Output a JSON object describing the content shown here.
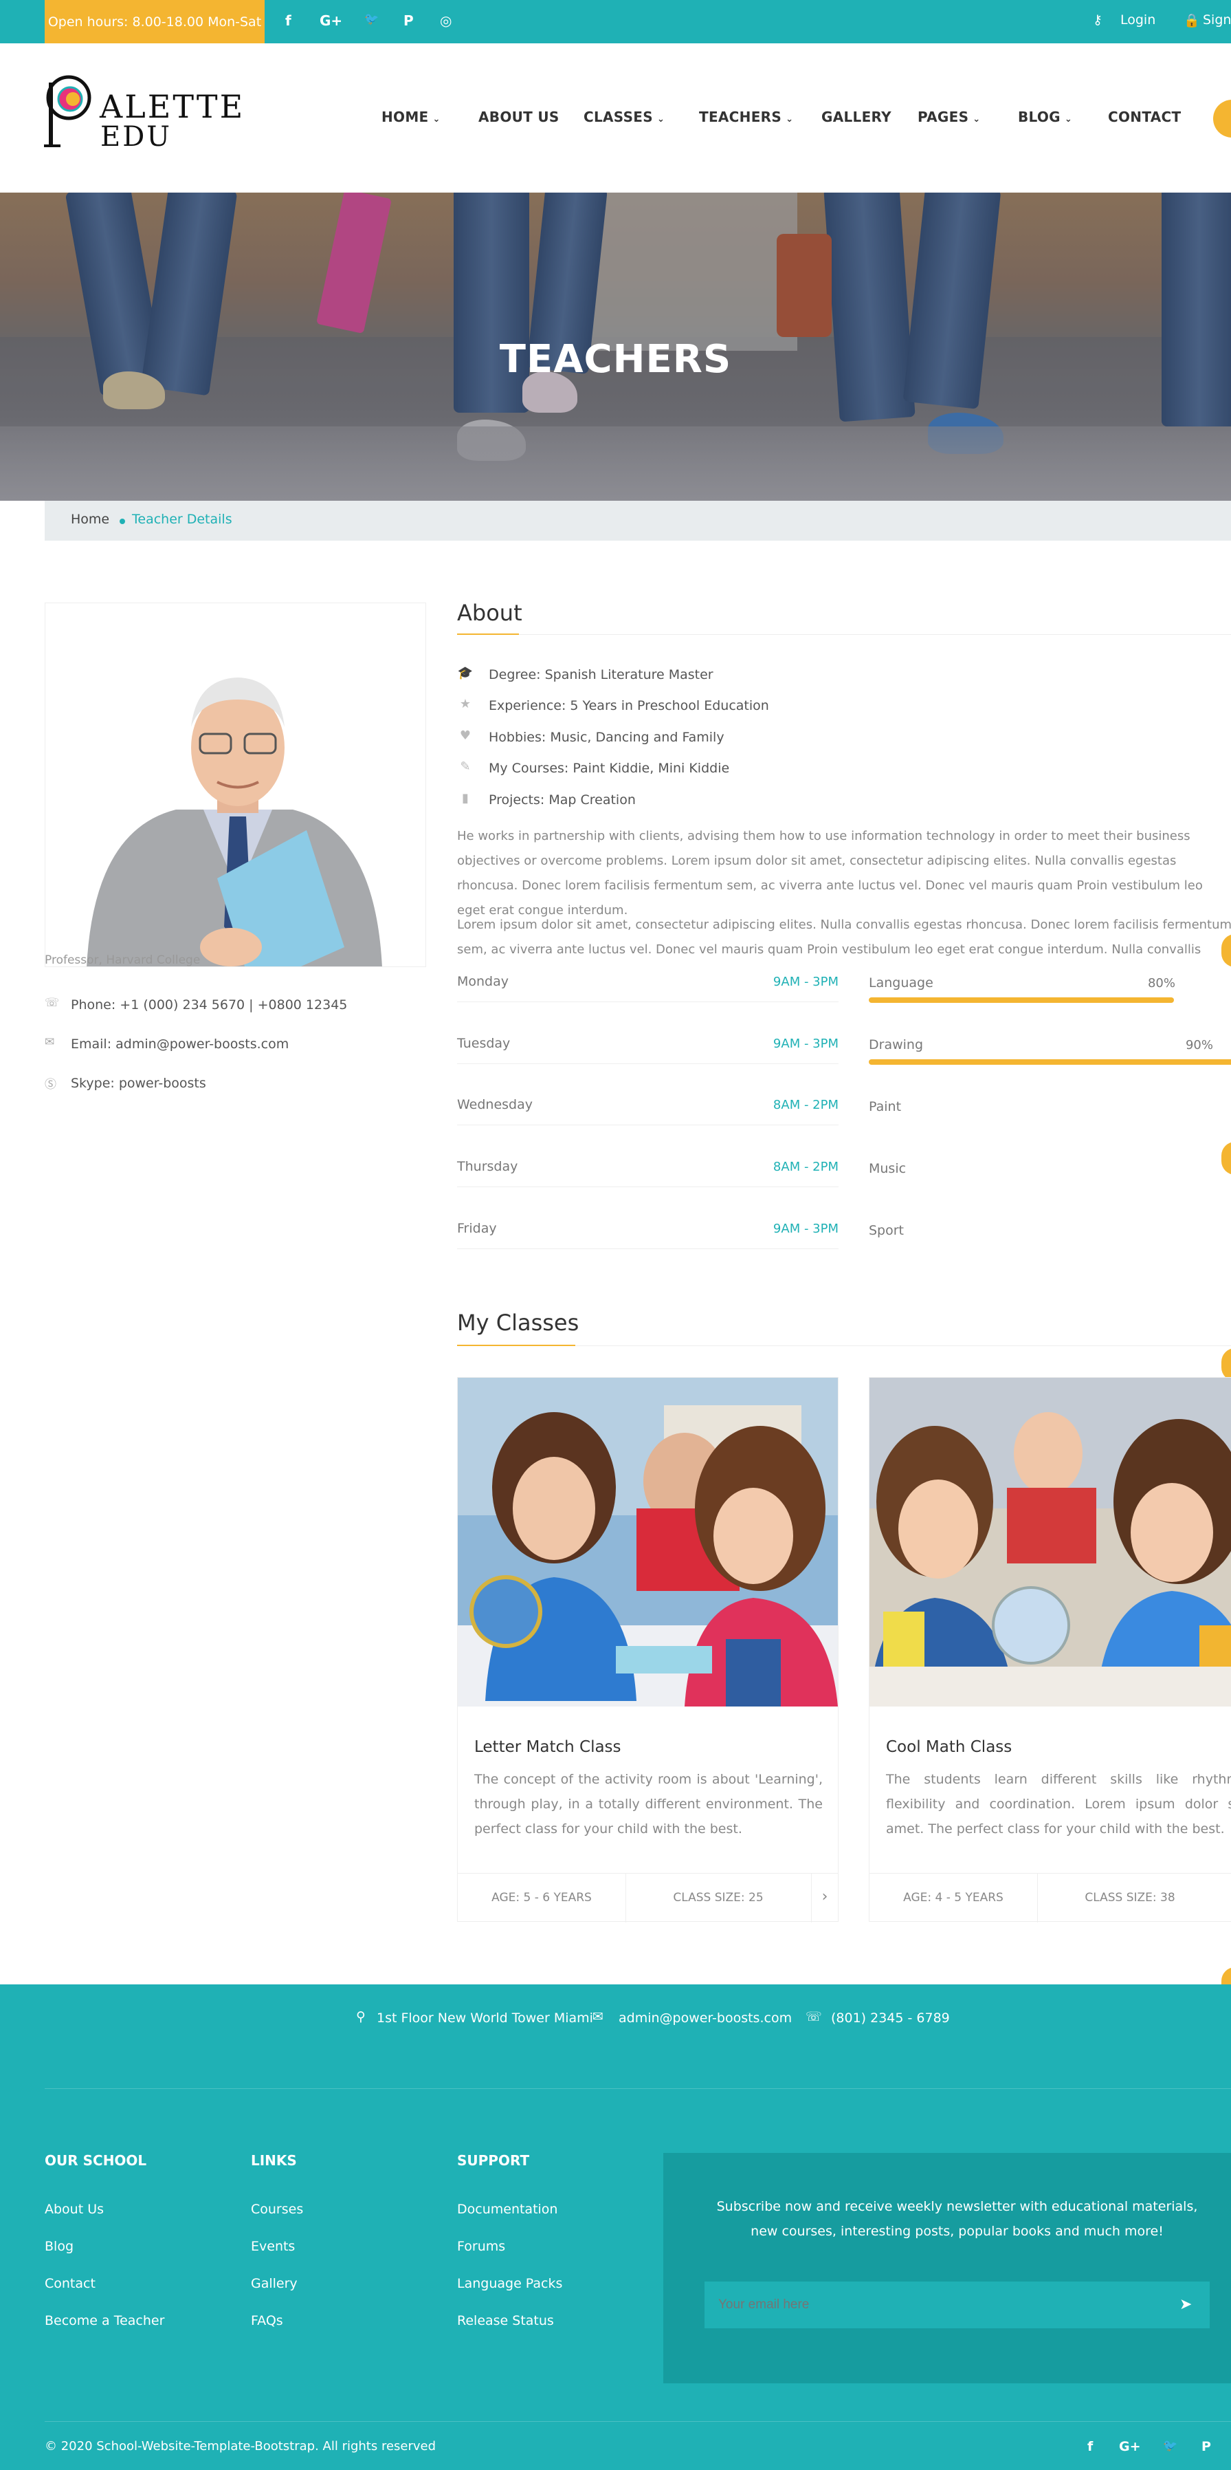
{
  "topbar": {
    "hours": "Open hours: 8.00-18.00 Mon-Sat",
    "social": [
      "f",
      "G+",
      "🐦",
      "P",
      "◎"
    ],
    "login": "Login",
    "sign": "Sign"
  },
  "header": {
    "logo_line1": "ALETTE",
    "logo_line2": "EDU",
    "nav": [
      {
        "label": "HOME",
        "dropdown": true
      },
      {
        "label": "ABOUT US",
        "dropdown": false
      },
      {
        "label": "CLASSES",
        "dropdown": true
      },
      {
        "label": "TEACHERS",
        "dropdown": true
      },
      {
        "label": "GALLERY",
        "dropdown": false
      },
      {
        "label": "PAGES",
        "dropdown": true
      },
      {
        "label": "BLOG",
        "dropdown": true
      },
      {
        "label": "CONTACT",
        "dropdown": false
      }
    ]
  },
  "hero": {
    "title": "TEACHERS"
  },
  "breadcrumb": {
    "home": "Home",
    "current": "Teacher Details"
  },
  "teacher": {
    "role": "Professor, Harvard College",
    "phone": "Phone: +1 (000) 234 5670 | +0800 12345",
    "email": "Email: admin@power-boosts.com",
    "skype": "Skype: power-boosts"
  },
  "about": {
    "heading": "About",
    "facts": [
      {
        "icon": "graduation-cap-icon",
        "glyph": "🎓",
        "text": "Degree: Spanish Literature Master"
      },
      {
        "icon": "star-icon",
        "glyph": "★",
        "text": "Experience: 5 Years in Preschool Education"
      },
      {
        "icon": "heart-icon",
        "glyph": "♥",
        "text": "Hobbies: Music, Dancing and Family"
      },
      {
        "icon": "edit-icon",
        "glyph": "✎",
        "text": "My Courses: Paint Kiddie, Mini Kiddie"
      },
      {
        "icon": "bookmark-icon",
        "glyph": "▮",
        "text": "Projects: Map Creation"
      }
    ],
    "para1": "He works in partnership with clients, advising them how to use information technology in order to meet their business objectives or overcome problems. Lorem ipsum dolor sit amet, consectetur adipiscing elites. Nulla convallis egestas rhoncusa. Donec lorem facilisis fermentum sem, ac viverra ante luctus vel. Donec vel mauris quam Proin vestibulum leo eget erat congue interdum.",
    "para2": "Lorem ipsum dolor sit amet, consectetur adipiscing elites. Nulla convallis egestas rhoncusa. Donec lorem facilisis fermentum sem, ac viverra ante luctus vel. Donec vel mauris quam Proin vestibulum leo eget erat congue interdum. Nulla convallis egestas"
  },
  "schedule": [
    {
      "day": "Monday",
      "time": "9AM - 3PM"
    },
    {
      "day": "Tuesday",
      "time": "9AM - 3PM"
    },
    {
      "day": "Wednesday",
      "time": "8AM - 2PM"
    },
    {
      "day": "Thursday",
      "time": "8AM - 2PM"
    },
    {
      "day": "Friday",
      "time": "9AM - 3PM"
    }
  ],
  "skills": [
    {
      "name": "Language",
      "percent_label": "80%",
      "level": 0.8
    },
    {
      "name": "Drawing",
      "percent_label": "90%",
      "level": 0.9
    },
    {
      "name": "Paint",
      "percent_label": "",
      "level": 0
    },
    {
      "name": "Music",
      "percent_label": "",
      "level": 0
    },
    {
      "name": "Sport",
      "percent_label": "",
      "level": 0
    }
  ],
  "classes": {
    "heading": "My Classes",
    "items": [
      {
        "title": "Letter Match Class",
        "text": "The concept of the activity room is about 'Learning', through play, in a totally different environment. The perfect class for your child with the best.",
        "age": "AGE: 5 - 6 YEARS",
        "size": "CLASS SIZE: 25"
      },
      {
        "title": "Cool Math Class",
        "text": "The students learn different skills like rhythm, flexibility and coordination. Lorem ipsum dolor sit amet. The perfect class for your child with the best.",
        "age": "AGE: 4 - 5 YEARS",
        "size": "CLASS SIZE: 38"
      }
    ],
    "next": "›"
  },
  "footer": {
    "address": "1st Floor New World Tower Miami",
    "email": "admin@power-boosts.com",
    "phone": "(801) 2345 - 6789",
    "cols": [
      {
        "heading": "OUR SCHOOL",
        "links": [
          "About Us",
          "Blog",
          "Contact",
          "Become a Teacher"
        ]
      },
      {
        "heading": "LINKS",
        "links": [
          "Courses",
          "Events",
          "Gallery",
          "FAQs"
        ]
      },
      {
        "heading": "SUPPORT",
        "links": [
          "Documentation",
          "Forums",
          "Language Packs",
          "Release Status"
        ]
      }
    ],
    "newsletter": "Subscribe now and receive weekly newsletter with educational materials, new courses, interesting posts, popular books and much more!",
    "email_placeholder": "Your email here",
    "copyright": "© 2020 School-Website-Template-Bootstrap. All rights reserved",
    "social": [
      "f",
      "G+",
      "🐦",
      "P"
    ]
  },
  "colors": {
    "teal": "#1fb1b5",
    "yellow": "#f4b531",
    "dark": "#333333"
  }
}
